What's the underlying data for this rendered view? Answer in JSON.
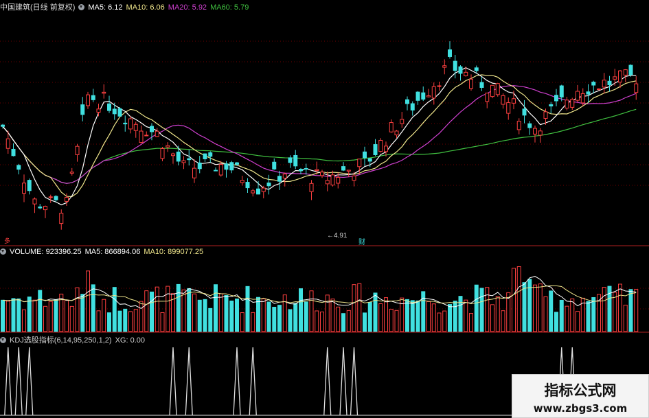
{
  "price_panel": {
    "stock_label": "中国建筑(日线 前复权)",
    "legend": [
      {
        "label": "MA5: 6.12",
        "color": "#ffffff"
      },
      {
        "label": "MA10: 6.06",
        "color": "#f0e68c"
      },
      {
        "label": "MA20: 5.92",
        "color": "#d040d0"
      },
      {
        "label": "MA60: 5.79",
        "color": "#40c040"
      }
    ],
    "low_marker": "4.91",
    "cai_marker": "财",
    "left_marker": "多"
  },
  "volume_panel": {
    "legend": [
      {
        "label": "VOLUME: 923396.25",
        "color": "#ffffff"
      },
      {
        "label": "MA5: 866894.06",
        "color": "#ffffff"
      },
      {
        "label": "MA10: 899077.25",
        "color": "#f0e68c"
      }
    ]
  },
  "kdj_panel": {
    "legend": [
      {
        "label": "KDJ选股指标(6,14,95,250,1,2)",
        "color": "#cfcfcf"
      },
      {
        "label": "XG: 0.00",
        "color": "#cfcfcf"
      }
    ]
  },
  "watermark": {
    "title": "指标公式网",
    "url": "www.zbgs3.com"
  },
  "colors": {
    "up": "#ff4040",
    "down": "#40e0e0",
    "ma5": "#ffffff",
    "ma10": "#f0e68c",
    "ma20": "#d040d0",
    "ma60": "#40c040",
    "grid": "#700000"
  },
  "chart_data": {
    "type": "candlestick",
    "xg_signal_bars": [
      1,
      3,
      5,
      32,
      35,
      44,
      47,
      61,
      64,
      66,
      105,
      107
    ]
  }
}
